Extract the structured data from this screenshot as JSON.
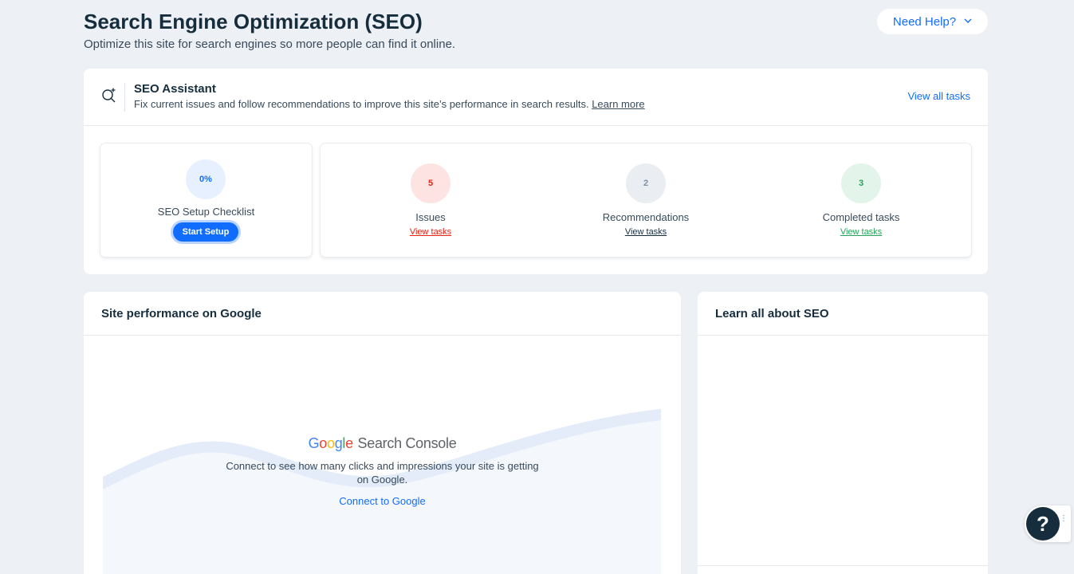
{
  "header": {
    "title": "Search Engine Optimization (SEO)",
    "subtitle": "Optimize this site for search engines so more people can find it online.",
    "help_button": "Need Help?"
  },
  "seo_assistant": {
    "title": "SEO Assistant",
    "description": "Fix current issues and follow recommendations to improve this site’s performance in search results.",
    "learn_more": "Learn more",
    "view_all": "View all tasks",
    "checklist": {
      "progress": "0%",
      "label": "SEO Setup Checklist",
      "button": "Start Setup"
    },
    "stats": [
      {
        "count": "5",
        "label": "Issues",
        "link": "View tasks"
      },
      {
        "count": "2",
        "label": "Recommendations",
        "link": "View tasks"
      },
      {
        "count": "3",
        "label": "Completed tasks",
        "link": "View tasks"
      }
    ]
  },
  "performance": {
    "title": "Site performance on Google",
    "logo_google": "Google",
    "logo_product": "Search Console",
    "text": "Connect to see how many clicks and impressions your site is getting on Google.",
    "connect": "Connect to Google"
  },
  "learn": {
    "title": "Learn all about SEO"
  },
  "fab": {
    "label": "?"
  },
  "colors": {
    "accent": "#116dff",
    "issues": "#e62214",
    "completed": "#25a55a",
    "background": "#edf0f5"
  }
}
